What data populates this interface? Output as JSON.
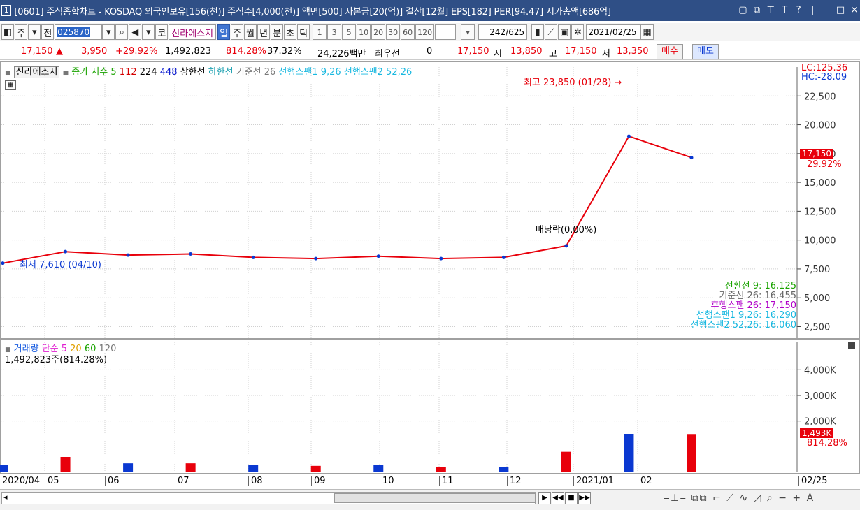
{
  "window": {
    "title": "[0601] 주식종합차트 - KOSDAQ 외국인보유[156(천)] 주식수[4,000(천)] 액면[500] 자본금[20(억)] 결산[12월] EPS[182] PER[94.47] 시가총액[686억]",
    "icon_label": "1"
  },
  "toolbar": {
    "period_label": "주",
    "ref_label": "전",
    "code": "025870",
    "market_label": "코",
    "stock_name": "신라에스지",
    "period_buttons": [
      "일",
      "주",
      "월",
      "년",
      "분",
      "초",
      "틱"
    ],
    "interval_buttons": [
      "1",
      "3",
      "5",
      "10",
      "20",
      "30",
      "60",
      "120"
    ],
    "count": "242",
    "total": "/625",
    "date": "2021/02/25"
  },
  "quote": {
    "price": "17,150",
    "arrow": "▲",
    "change": "3,950",
    "change_pct": "+29.92%",
    "volume": "1,492,823",
    "vol_ratio": "814.28%",
    "turnover": "37.32%",
    "amount": "24,226백만",
    "priority_label": "최우선",
    "priority_value": "0",
    "ask_price": "17,150",
    "open_label": "시",
    "open": "13,850",
    "high_label": "고",
    "high": "17,150",
    "low_label": "저",
    "low": "13,350",
    "buy_label": "매수",
    "sell_label": "매도"
  },
  "price_pane": {
    "legend": {
      "name": "신라에스지",
      "close_label": "종가 지수 5",
      "ma112": "112",
      "ma224": "224",
      "ma448": "448",
      "upper": "상한선",
      "lower": "하한선",
      "base": "기준선 26",
      "span1": "선행스팬1 9,26",
      "span2": "선행스팬2 52,26"
    },
    "lc": "LC:125.36",
    "hc": "HC:-28.09",
    "high_anno": "최고 23,850 (01/28) →",
    "dividend_anno": "배당락(0.00%)",
    "low_anno": "최저 7,610 (04/10)",
    "price_tag": "17,150",
    "pct_tag": "29.92%",
    "ichimoku": [
      "전환선 9: 16,125",
      "기준선 26: 16,455",
      "후행스팬 26: 17,150",
      "선행스팬1 9,26: 16,290",
      "선행스팬2 52,26: 16,060"
    ]
  },
  "volume_pane": {
    "legend": {
      "name": "거래량",
      "simple": "단순 5",
      "ma20": "20",
      "ma60": "60",
      "ma120": "120"
    },
    "info": "1,492,823주(814.28%)",
    "vol_tag": "1,493K",
    "pct_tag": "814.28%"
  },
  "x_axis": {
    "labels": [
      "2020/04",
      "05",
      "06",
      "07",
      "08",
      "09",
      "10",
      "11",
      "12",
      "2021/01",
      "02"
    ],
    "right_label": "02/25"
  },
  "colors": {
    "up": "#e8000b",
    "down": "#0a38d1",
    "cloud": "#1ec8f5",
    "title_bar": "#2f4f86"
  },
  "chart_data": [
    {
      "type": "line",
      "title": "",
      "x": [
        "2020/04",
        "2020/05",
        "2020/06",
        "2020/07",
        "2020/08",
        "2020/09",
        "2020/10",
        "2020/11",
        "2020/12",
        "2021/01",
        "2021/02",
        "2021/02/25"
      ],
      "series": [
        {
          "name": "종가",
          "values": [
            8000,
            9000,
            8700,
            8800,
            8500,
            8400,
            8600,
            8400,
            8500,
            9500,
            19000,
            17150
          ]
        }
      ],
      "y_ticks": [
        2500,
        5000,
        7500,
        10000,
        12500,
        15000,
        17500,
        20000,
        22500
      ],
      "ylim": [
        1500,
        25000
      ]
    },
    {
      "type": "bar",
      "title": "",
      "categories": [
        "2020/04",
        "2020/05",
        "2020/06",
        "2020/07",
        "2020/08",
        "2020/09",
        "2020/10",
        "2020/11",
        "2020/12",
        "2021/01",
        "2021/02",
        "2021/02/25"
      ],
      "series": [
        {
          "name": "거래량",
          "values": [
            300,
            600,
            350,
            350,
            300,
            250,
            300,
            200,
            200,
            800,
            1500,
            1493
          ]
        }
      ],
      "y_ticks": [
        "2,000K",
        "3,000K",
        "4,000K"
      ],
      "ylim": [
        0,
        4800
      ]
    }
  ]
}
